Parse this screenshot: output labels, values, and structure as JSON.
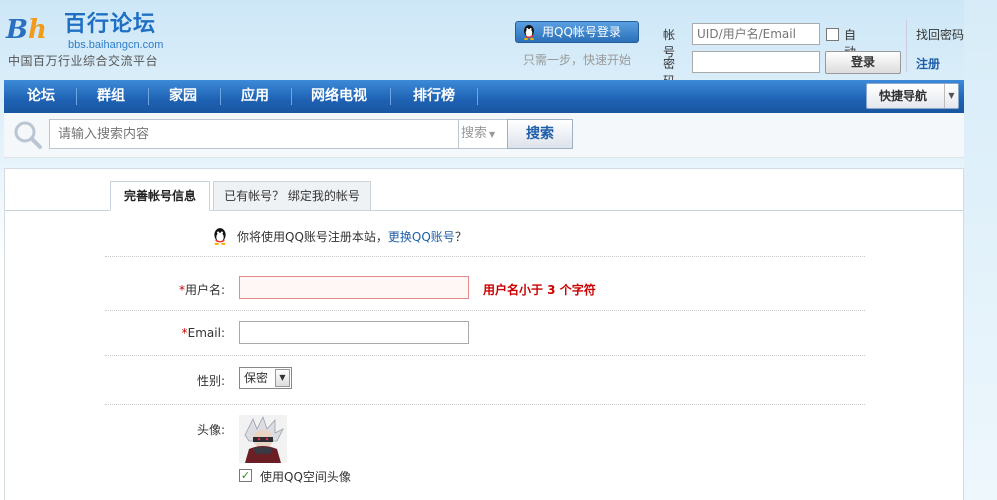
{
  "header": {
    "logo": {
      "title": "百行论坛",
      "url": "bbs.baihangcn.com",
      "slogan": "中国百万行业综合交流平台"
    },
    "qq_login": {
      "button_label": "用QQ帐号登录",
      "tip": "只需一步，快速开始"
    },
    "login_form": {
      "account_label": "帐号",
      "account_placeholder": "UID/用户名/Email",
      "password_label": "密码",
      "auto_login_label": "自动登录",
      "login_button": "登录",
      "forgot_password": "找回密码",
      "register": "注册"
    }
  },
  "nav": {
    "items": [
      "论坛",
      "群组",
      "家园",
      "应用",
      "网络电视",
      "排行榜"
    ],
    "quick_nav_label": "快捷导航"
  },
  "search": {
    "placeholder": "请输入搜索内容",
    "type_label": "搜索",
    "button_label": "搜索"
  },
  "register_panel": {
    "tabs": [
      {
        "label": "完善帐号信息",
        "active": true
      },
      {
        "label": "已有帐号？ 绑定我的帐号",
        "active": false
      }
    ],
    "notice_prefix": "你将使用QQ账号注册本站，",
    "notice_link": "更换QQ账号",
    "notice_suffix": "？",
    "fields": {
      "username_label": "用户名:",
      "username_error": "用户名小于 3 个字符",
      "email_label": "Email:",
      "gender_label": "性别:",
      "gender_value": "保密",
      "avatar_label": "头像:",
      "use_qq_avatar_label": "使用QQ空间头像",
      "use_qq_avatar_checked": true,
      "required_mark": "*"
    }
  },
  "colors": {
    "nav_blue": "#1f62b3",
    "link_blue": "#1f5fa8",
    "error_red": "#cc0000"
  }
}
